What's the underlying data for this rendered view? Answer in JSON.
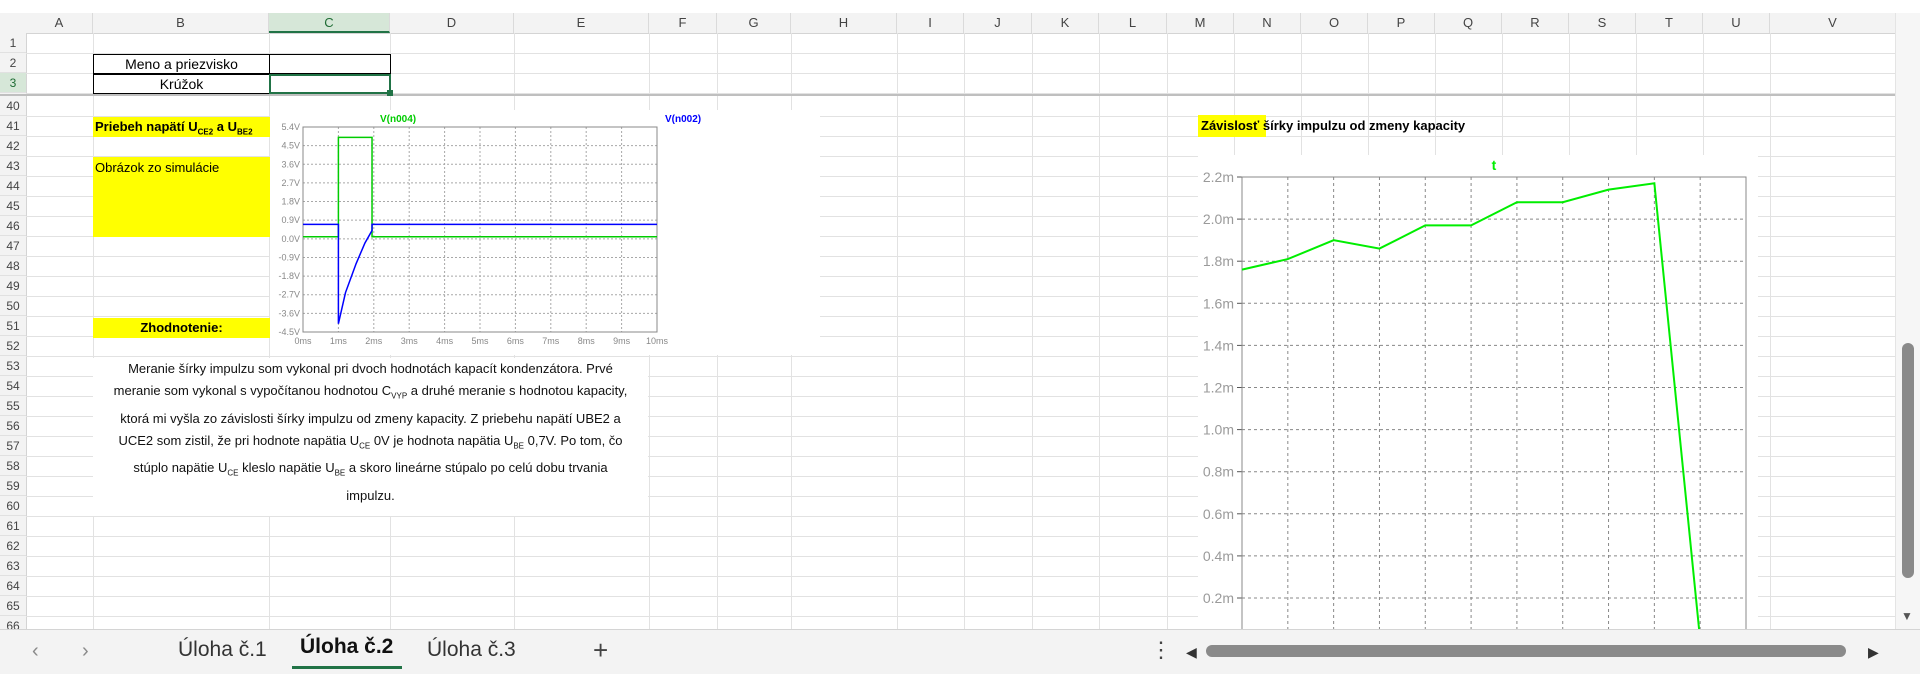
{
  "columns": [
    "A",
    "B",
    "C",
    "D",
    "E",
    "F",
    "G",
    "H",
    "I",
    "J",
    "K",
    "L",
    "M",
    "N",
    "O",
    "P",
    "Q",
    "R",
    "S",
    "T",
    "U",
    "V"
  ],
  "selected_column": "C",
  "rows": [
    "1",
    "2",
    "3",
    "40",
    "41",
    "42",
    "43",
    "44",
    "45",
    "46",
    "47",
    "48",
    "49",
    "50",
    "51",
    "52",
    "53",
    "54",
    "55",
    "56",
    "57",
    "58",
    "59",
    "60",
    "61",
    "62",
    "63",
    "64",
    "65",
    "66"
  ],
  "selected_row": "3",
  "cells": {
    "b2": "Meno a priezvisko",
    "b3": "Krúžok",
    "title_priebeh": "Priebeh napätí U",
    "sub_ce2": "CE2",
    "title_a": " a U",
    "sub_be2": "BE2",
    "obrazok": "Obrázok zo simulácie",
    "zhodnotenie": "Zhodnotenie:",
    "title_zavislost": "Závislosť šírky impulzu od zmeny kapacity"
  },
  "paragraph": {
    "line1": "Meranie šírky impulzu som vykonal pri dvoch hodnotách kapacít kondenzátora. Prvé",
    "line2_a": "meranie som vykonal s vypočítanou hodnotou C",
    "line2_sub": "VYP",
    "line2_b": " a druhé meranie s hodnotou kapacity,",
    "line3": "ktorá mi vyšla zo závislosti šírky impulzu od zmeny kapacity. Z priebehu napätí UBE2 a",
    "line4_a": "UCE2 som zistil, že pri hodnote napätia U",
    "line4_sub1": "CE",
    "line4_b": " 0V je hodnota napätia U",
    "line4_sub2": "BE",
    "line4_c": " 0,7V. Po tom, čo",
    "line5_a": "stúplo napätie U",
    "line5_sub1": "CE",
    "line5_b": " kleslo napätie U",
    "line5_sub2": "BE",
    "line5_c": " a skoro lineárne stúpalo po celú dobu trvania",
    "line6": "impulzu."
  },
  "chart_data": [
    {
      "type": "line",
      "title": "",
      "legend": [
        "V(n004)",
        "V(n002)"
      ],
      "colors": [
        "#00cc00",
        "#0000ff"
      ],
      "x_ticks": [
        "0ms",
        "1ms",
        "2ms",
        "3ms",
        "4ms",
        "5ms",
        "6ms",
        "7ms",
        "8ms",
        "9ms",
        "10ms"
      ],
      "y_ticks": [
        "5.4V",
        "4.5V",
        "3.6V",
        "2.7V",
        "1.8V",
        "0.9V",
        "0.0V",
        "-0.9V",
        "-1.8V",
        "-2.7V",
        "-3.6V",
        "-4.5V"
      ],
      "xlim": [
        0,
        10
      ],
      "ylim": [
        -4.5,
        5.4
      ],
      "series": [
        {
          "name": "V(n004)",
          "x": [
            0,
            1,
            1,
            1.95,
            1.95,
            10
          ],
          "y": [
            0.1,
            0.1,
            4.9,
            4.9,
            0.1,
            0.1
          ]
        },
        {
          "name": "V(n002)",
          "x": [
            0,
            1,
            1,
            1.2,
            1.5,
            1.75,
            1.95,
            1.95,
            10
          ],
          "y": [
            0.7,
            0.7,
            -4.1,
            -2.6,
            -1.2,
            -0.2,
            0.4,
            0.7,
            0.7
          ]
        }
      ],
      "grid": true
    },
    {
      "type": "line",
      "title": "t",
      "color": "#00ee00",
      "y_ticks": [
        "2.2m",
        "2.0m",
        "1.8m",
        "1.6m",
        "1.4m",
        "1.2m",
        "1.0m",
        "0.8m",
        "0.6m",
        "0.4m",
        "0.2m"
      ],
      "ylim": [
        0.0001,
        0.0022
      ],
      "xlim": [
        0,
        11
      ],
      "series": [
        {
          "name": "",
          "x": [
            0,
            1,
            2,
            3,
            4,
            5,
            6,
            7,
            8,
            9,
            10,
            11
          ],
          "y": [
            0.00176,
            0.00181,
            0.0019,
            0.00186,
            0.00197,
            0.00197,
            0.00208,
            0.00208,
            0.00214,
            0.00217,
            0.0,
            0.0
          ]
        }
      ],
      "grid": true
    }
  ],
  "sheets": [
    "Úloha č.1",
    "Úloha č.2",
    "Úloha č.3"
  ],
  "active_sheet": "Úloha č.2",
  "add_sheet": "+",
  "more": "⋮",
  "nav_prev": "‹",
  "nav_next": "›",
  "scroll_left": "◀",
  "scroll_right": "▶"
}
